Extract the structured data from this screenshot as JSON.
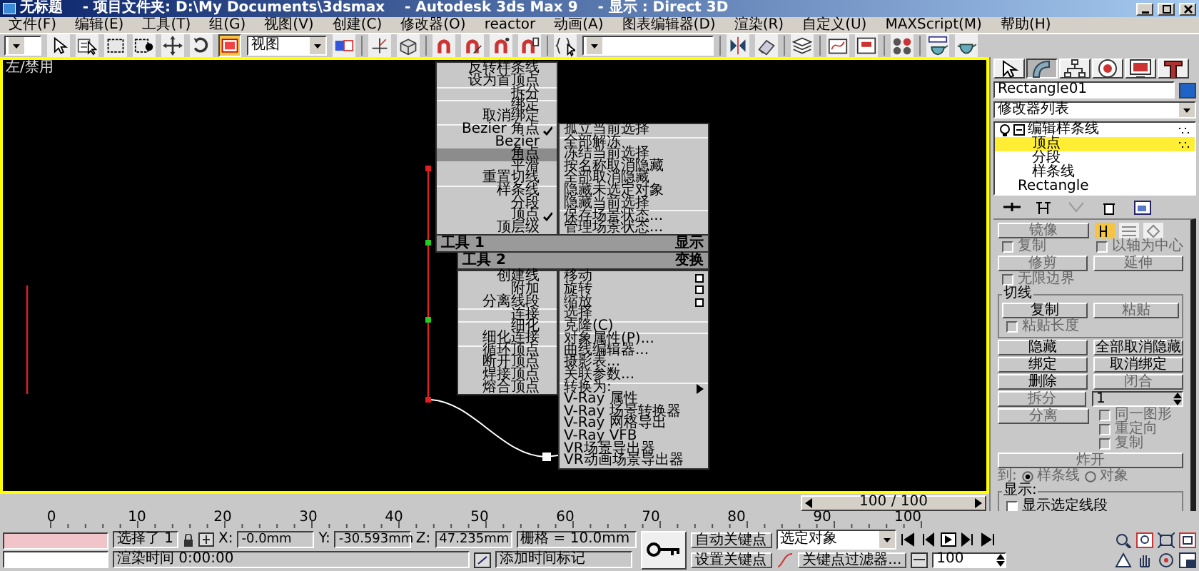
{
  "title_bar": {
    "title": "无标题    - 项目文件夹: D:\\My Documents\\3dsmax    - Autodesk 3ds Max 9    - 显示 : Direct 3D"
  },
  "menu_bar": [
    "文件(F)",
    "编辑(E)",
    "工具(T)",
    "组(G)",
    "视图(V)",
    "创建(C)",
    "修改器(O)",
    "reactor",
    "动画(A)",
    "图表编辑器(D)",
    "渲染(R)",
    "自定义(U)",
    "MAXScript(M)",
    "帮助(H)"
  ],
  "toolbar": {
    "tools": [
      {
        "selected": false
      },
      {
        "selected": false
      },
      {
        "selected": false
      },
      {
        "selected": false
      },
      {
        "selected": false
      },
      {
        "selected": false
      },
      {
        "selected": true
      }
    ],
    "reference_coordinates": "视图"
  },
  "viewport": {
    "label": "左/禁用"
  },
  "quad_menu": {
    "quadrants": [
      {
        "title": "工具 1",
        "groups": [
          [
            {
              "label": "反转样条线",
              "kind": "command",
              "checked": false,
              "selected": false
            },
            {
              "label": "设为首顶点",
              "kind": "command",
              "checked": false,
              "selected": false
            }
          ],
          [
            {
              "label": "拆分",
              "kind": "command",
              "checked": false,
              "selected": false
            }
          ],
          [
            {
              "label": "绑定",
              "kind": "command",
              "checked": false,
              "selected": false
            },
            {
              "label": "取消绑定",
              "kind": "command",
              "checked": false,
              "selected": false
            }
          ],
          [
            {
              "label": "Bezier 角点",
              "kind": "command",
              "checked": true,
              "selected": false
            },
            {
              "label": "Bezier",
              "kind": "command",
              "checked": false,
              "selected": false
            },
            {
              "label": "角点",
              "kind": "command",
              "checked": false,
              "selected": true
            },
            {
              "label": "平滑",
              "kind": "command",
              "checked": false,
              "selected": false
            },
            {
              "label": "重置切线",
              "kind": "command",
              "checked": false,
              "selected": false
            }
          ],
          [
            {
              "label": "样条线",
              "kind": "command",
              "checked": false,
              "selected": false
            },
            {
              "label": "分段",
              "kind": "command",
              "checked": false,
              "selected": false
            },
            {
              "label": "顶点",
              "kind": "command",
              "checked": true,
              "selected": false
            },
            {
              "label": "顶层级",
              "kind": "command",
              "checked": false,
              "selected": false
            }
          ]
        ]
      },
      {
        "title": "显示",
        "groups": [
          [
            {
              "label": "孤立当前选择",
              "kind": "command",
              "checked": false,
              "selected": false
            }
          ],
          [
            {
              "label": "全部解冻",
              "kind": "command",
              "checked": false,
              "selected": false
            },
            {
              "label": "冻结当前选择",
              "kind": "command",
              "checked": false,
              "selected": false
            },
            {
              "label": "按名称取消隐藏",
              "kind": "command",
              "checked": false,
              "selected": false
            },
            {
              "label": "全部取消隐藏",
              "kind": "command",
              "checked": false,
              "selected": false
            },
            {
              "label": "隐藏未选定对象",
              "kind": "command",
              "checked": false,
              "selected": false
            },
            {
              "label": "隐藏当前选择",
              "kind": "command",
              "checked": false,
              "selected": false
            }
          ],
          [
            {
              "label": "保存场景状态...",
              "kind": "command",
              "checked": false,
              "selected": false
            },
            {
              "label": "管理场景状态...",
              "kind": "command",
              "checked": false,
              "selected": false
            }
          ]
        ]
      },
      {
        "title": "工具 2",
        "groups": [
          [
            {
              "label": "创建线",
              "kind": "command",
              "checked": false,
              "selected": false
            },
            {
              "label": "附加",
              "kind": "command",
              "checked": false,
              "selected": false
            },
            {
              "label": "分离线段",
              "kind": "command",
              "checked": false,
              "selected": false
            }
          ],
          [
            {
              "label": "连接",
              "kind": "command",
              "checked": false,
              "selected": false
            }
          ],
          [
            {
              "label": "细化",
              "kind": "command",
              "checked": false,
              "selected": false
            },
            {
              "label": "细化连接",
              "kind": "command",
              "checked": false,
              "selected": false
            }
          ],
          [
            {
              "label": "循环顶点",
              "kind": "command",
              "checked": false,
              "selected": false
            },
            {
              "label": "断开顶点",
              "kind": "command",
              "checked": false,
              "selected": false
            },
            {
              "label": "焊接顶点",
              "kind": "command",
              "checked": false,
              "selected": false
            },
            {
              "label": "熔合顶点",
              "kind": "command",
              "checked": false,
              "selected": false
            }
          ]
        ]
      },
      {
        "title": "变换",
        "groups": [
          [
            {
              "label": "移动",
              "kind": "options",
              "checked": false,
              "selected": false
            },
            {
              "label": "旋转",
              "kind": "options",
              "checked": false,
              "selected": false
            },
            {
              "label": "缩放",
              "kind": "options",
              "checked": false,
              "selected": false
            },
            {
              "label": "选择",
              "kind": "command",
              "checked": false,
              "selected": false
            }
          ],
          [
            {
              "label": "克隆(C)",
              "kind": "command",
              "checked": false,
              "selected": false
            }
          ],
          [
            {
              "label": "对象属性(P)...",
              "kind": "command",
              "checked": false,
              "selected": false
            },
            {
              "label": "曲线编辑器...",
              "kind": "command",
              "checked": false,
              "selected": false
            },
            {
              "label": "摄影表...",
              "kind": "command",
              "checked": false,
              "selected": false
            },
            {
              "label": "关联参数...",
              "kind": "command",
              "checked": false,
              "selected": false
            }
          ],
          [
            {
              "label": "转换为:",
              "kind": "submenu",
              "checked": false,
              "selected": false
            },
            {
              "label": "V-Ray 属性",
              "kind": "command",
              "checked": false,
              "selected": false
            },
            {
              "label": "V-Ray 场景转换器",
              "kind": "command",
              "checked": false,
              "selected": false
            },
            {
              "label": "V-Ray 网格导出",
              "kind": "command",
              "checked": false,
              "selected": false
            },
            {
              "label": "V-Ray VFB",
              "kind": "command",
              "checked": false,
              "selected": false
            },
            {
              "label": "VR场景导出器",
              "kind": "command",
              "checked": false,
              "selected": false
            },
            {
              "label": "VR动画场景导出器",
              "kind": "command",
              "checked": false,
              "selected": false
            }
          ]
        ]
      }
    ]
  },
  "command_panel": {
    "tabs": [
      {
        "selected": false
      },
      {
        "selected": true
      },
      {
        "selected": false
      },
      {
        "selected": false
      },
      {
        "selected": false
      },
      {
        "selected": false
      }
    ],
    "object_name": "Rectangle01",
    "modifier_list": "修改器列表",
    "stack": [
      {
        "label": "编辑样条线",
        "expanded": true,
        "selected": false,
        "children": [
          {
            "label": "顶点",
            "selected": true
          },
          {
            "label": "分段",
            "selected": false
          },
          {
            "label": "样条线",
            "selected": false
          }
        ]
      },
      {
        "label": "Rectangle",
        "selected": false
      }
    ],
    "rollout": [
      {
        "kind": "row",
        "controls": [
          {
            "kind": "button",
            "label": "镜像",
            "disabled": true
          },
          {
            "kind": "modes",
            "items": [
              {
                "selected": true
              },
              {
                "selected": false
              },
              {
                "selected": false
              }
            ]
          }
        ]
      },
      {
        "kind": "row",
        "controls": [
          {
            "kind": "checkbox",
            "label": "复制",
            "checked": false,
            "disabled": true
          },
          {
            "kind": "checkbox",
            "label": "以轴为中心",
            "checked": false,
            "disabled": true
          }
        ]
      },
      {
        "kind": "row",
        "controls": [
          {
            "kind": "button",
            "label": "修剪",
            "disabled": true
          },
          {
            "kind": "button",
            "label": "延伸",
            "disabled": true
          }
        ]
      },
      {
        "kind": "row",
        "controls": [
          {
            "kind": "checkbox",
            "label": "无限边界",
            "checked": false,
            "disabled": true
          }
        ]
      },
      {
        "kind": "group",
        "title": "切线",
        "rows": [
          {
            "kind": "row",
            "controls": [
              {
                "kind": "button",
                "label": "复制",
                "disabled": false
              },
              {
                "kind": "button",
                "label": "粘贴",
                "disabled": true
              }
            ]
          },
          {
            "kind": "row",
            "controls": [
              {
                "kind": "checkbox",
                "label": "粘贴长度",
                "checked": false,
                "disabled": true
              }
            ]
          }
        ]
      },
      {
        "kind": "row",
        "controls": [
          {
            "kind": "button",
            "label": "隐藏",
            "disabled": false
          },
          {
            "kind": "button",
            "label": "全部取消隐藏",
            "disabled": false
          }
        ]
      },
      {
        "kind": "row",
        "controls": [
          {
            "kind": "button",
            "label": "绑定",
            "disabled": false
          },
          {
            "kind": "button",
            "label": "取消绑定",
            "disabled": false
          }
        ]
      },
      {
        "kind": "row",
        "controls": [
          {
            "kind": "button",
            "label": "删除",
            "disabled": false
          },
          {
            "kind": "button",
            "label": "闭合",
            "disabled": true
          }
        ]
      },
      {
        "kind": "row",
        "controls": [
          {
            "kind": "button",
            "label": "拆分",
            "disabled": true
          },
          {
            "kind": "spinner",
            "value": "1",
            "disabled": true
          }
        ]
      },
      {
        "kind": "row",
        "controls": [
          {
            "kind": "button",
            "label": "分离",
            "disabled": true
          },
          {
            "kind": "checklist",
            "items": [
              {
                "label": "同一图形",
                "checked": false,
                "disabled": true
              },
              {
                "label": "重定向",
                "checked": false,
                "disabled": true
              },
              {
                "label": "复制",
                "checked": false,
                "disabled": true
              }
            ]
          }
        ]
      },
      {
        "kind": "row",
        "controls": [
          {
            "kind": "button",
            "label": "炸开",
            "disabled": true
          }
        ]
      },
      {
        "kind": "row",
        "controls": [
          {
            "kind": "radio_group",
            "label": "到:",
            "disabled": true,
            "options": [
              {
                "label": "样条线",
                "selected": true
              },
              {
                "label": "对象",
                "selected": false
              }
            ]
          }
        ]
      },
      {
        "kind": "group",
        "title": "显示:",
        "rows": [
          {
            "kind": "row",
            "controls": [
              {
                "kind": "checkbox",
                "label": "显示选定线段",
                "checked": false,
                "disabled": false
              }
            ]
          }
        ]
      }
    ]
  },
  "time_slider": {
    "label": "100 / 100",
    "level": 1
  },
  "ruler_labels": [
    "0",
    "10",
    "20",
    "30",
    "40",
    "50",
    "60",
    "70",
    "80",
    "90",
    "100"
  ],
  "status_bar": {
    "selection": "选择了 1",
    "coordinates": [
      {
        "label": "X:",
        "value": "-0.0mm"
      },
      {
        "label": "Y:",
        "value": "-30.593mm"
      },
      {
        "label": "Z:",
        "value": "47.235mm"
      }
    ],
    "grid": "栅格 = 10.0mm",
    "render_time_label": "渲染时间",
    "render_time": "0:00:00",
    "add_time_tag": "添加时间标记",
    "auto_key": "自动关键点",
    "key_mode": "选定对象",
    "set_key": "设置关键点",
    "key_filters": "关键点过滤器...",
    "frame": "100"
  }
}
